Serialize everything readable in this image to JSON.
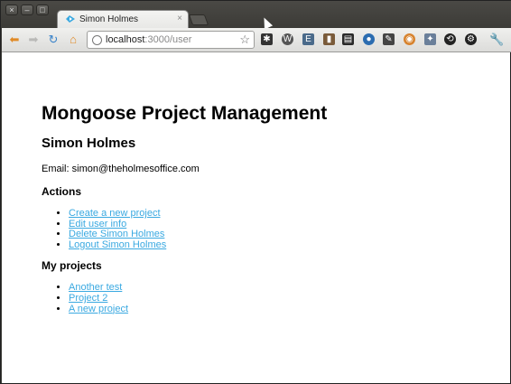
{
  "browser": {
    "tab_title": "Simon Holmes",
    "tab_close": "×",
    "url_host": "localhost",
    "url_path": ":3000/user",
    "window_buttons": [
      "×",
      "–",
      "□"
    ]
  },
  "colors": {
    "link": "#3aa9e1",
    "tab_active": "#f4f4f2",
    "frame": "#3c3b37"
  },
  "page": {
    "title": "Mongoose Project Management",
    "user_name": "Simon Holmes",
    "email_label": "Email:",
    "email_value": "simon@theholmesoffice.com",
    "actions_heading": "Actions",
    "actions": [
      "Create a new project",
      "Edit user info",
      "Delete Simon Holmes",
      "Logout Simon Holmes"
    ],
    "projects_heading": "My projects",
    "projects": [
      "Another test",
      "Project 2",
      "A new project"
    ]
  }
}
